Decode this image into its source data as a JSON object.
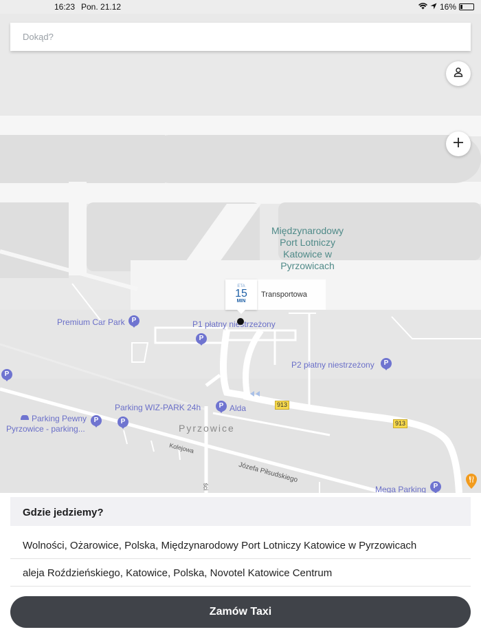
{
  "status_bar": {
    "time": "16:23",
    "date": "Pon. 21.12",
    "battery": "16%",
    "battery_level": 0.16
  },
  "search": {
    "placeholder": "Dokąd?"
  },
  "map": {
    "airport_name": [
      "Międzynarodowy",
      "Port Lotniczy",
      "Katowice w",
      "Pyrzowicach"
    ],
    "eta": {
      "label": "ETA",
      "value": "15",
      "unit": "MIN",
      "street": "Transportowa"
    },
    "pois": [
      {
        "name": "Premium Car Park"
      },
      {
        "name": "P1 płatny niestrzeżony"
      },
      {
        "name": "P2 płatny niestrzeżony"
      },
      {
        "name": "Parking WIZ-PARK 24h"
      },
      {
        "name": "Alda"
      },
      {
        "name": "Parking Pewny Pyrzowice - parking..."
      },
      {
        "name": "Mega Parking"
      }
    ],
    "town": "Pyrzowice",
    "streets": [
      "Kolejowa",
      "Józefa Piłsudskiego",
      "ści"
    ],
    "road_numbers": [
      "913",
      "913"
    ],
    "pin_symbol": "P"
  },
  "sheet": {
    "title": "Gdzie jedziemy?",
    "suggestions": [
      "Wolności, Ożarowice, Polska, Międzynarodowy Port Lotniczy Katowice w Pyrzowicach",
      "aleja Roździeńskiego, Katowice, Polska, Novotel Katowice Centrum"
    ],
    "order_button": "Zamów Taxi"
  },
  "colors": {
    "map_background": "#e9e9e9",
    "road": "#ffffff",
    "poi": "#6a6fc8",
    "airport_label": "#4f8a88",
    "button": "#404349"
  }
}
